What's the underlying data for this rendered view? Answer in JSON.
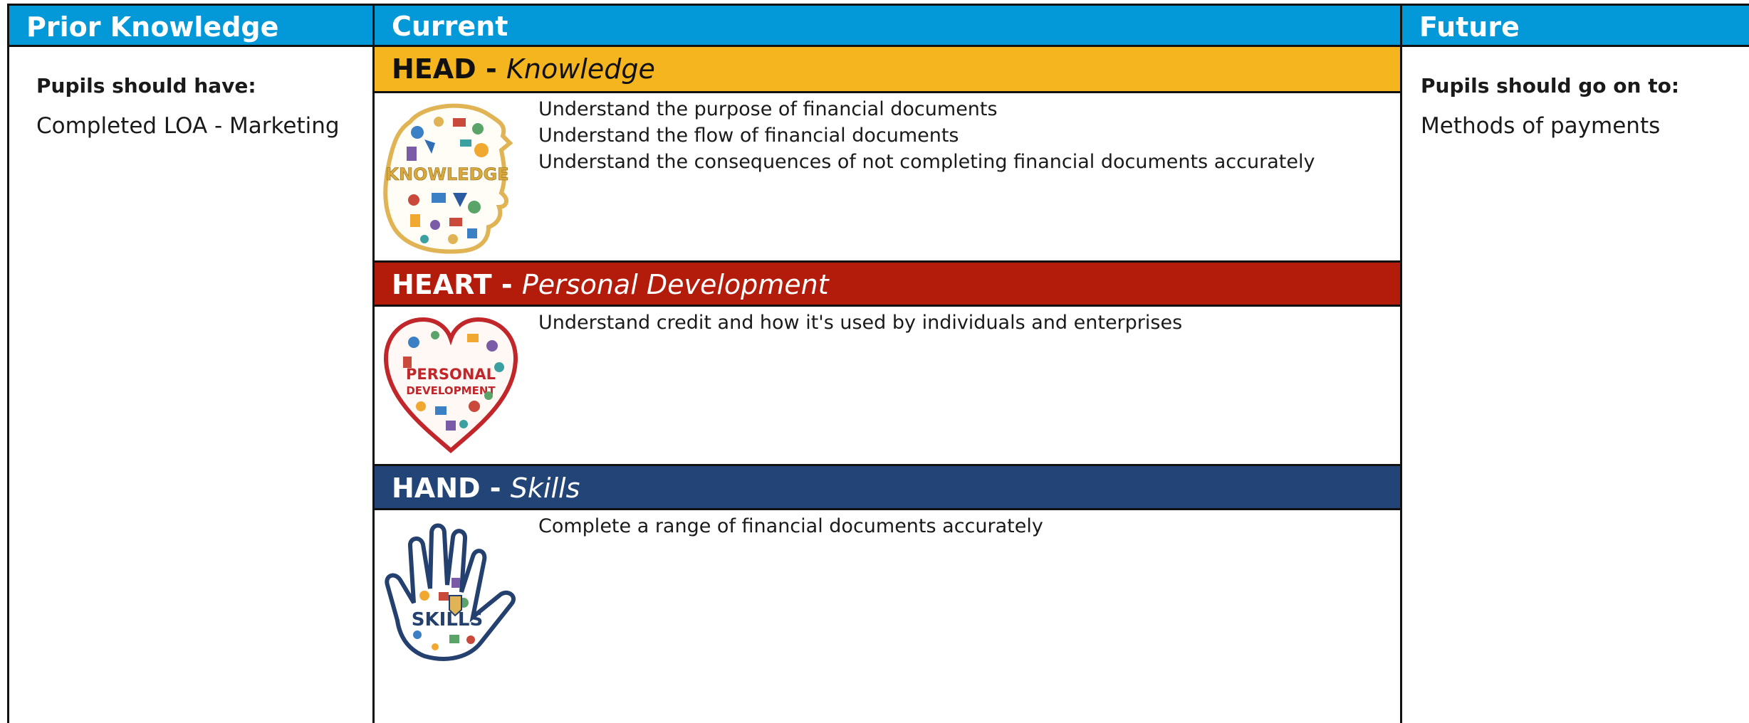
{
  "columns": {
    "prior": {
      "title": "Prior Knowledge",
      "label": "Pupils should have:",
      "value": "Completed LOA - Marketing"
    },
    "current": {
      "title": "Current"
    },
    "future": {
      "title": "Future",
      "label": "Pupils should go on to:",
      "value": "Methods of payments"
    }
  },
  "sections": {
    "head": {
      "prefix": "HEAD - ",
      "subtitle": "Knowledge",
      "color": "#f5b51e",
      "icon": "knowledge-head-icon",
      "items": [
        "Understand the purpose of financial documents",
        "Understand the flow of financial documents",
        "Understand the consequences of not completing financial documents accurately"
      ]
    },
    "heart": {
      "prefix": "HEART - ",
      "subtitle": "Personal Development",
      "color": "#b31b0a",
      "icon": "personal-development-heart-icon",
      "items": [
        "Understand credit and how it's used by individuals and enterprises"
      ]
    },
    "hand": {
      "prefix": "HAND - ",
      "subtitle": "Skills",
      "color": "#234476",
      "icon": "skills-hand-icon",
      "items": [
        "Complete a range of financial documents accurately"
      ]
    }
  },
  "illustrations": {
    "head_word": "KNOWLEDGE",
    "heart_word_1": "PERSONAL",
    "heart_word_2": "DEVELOPMENT",
    "hand_word": "SKILLS"
  }
}
